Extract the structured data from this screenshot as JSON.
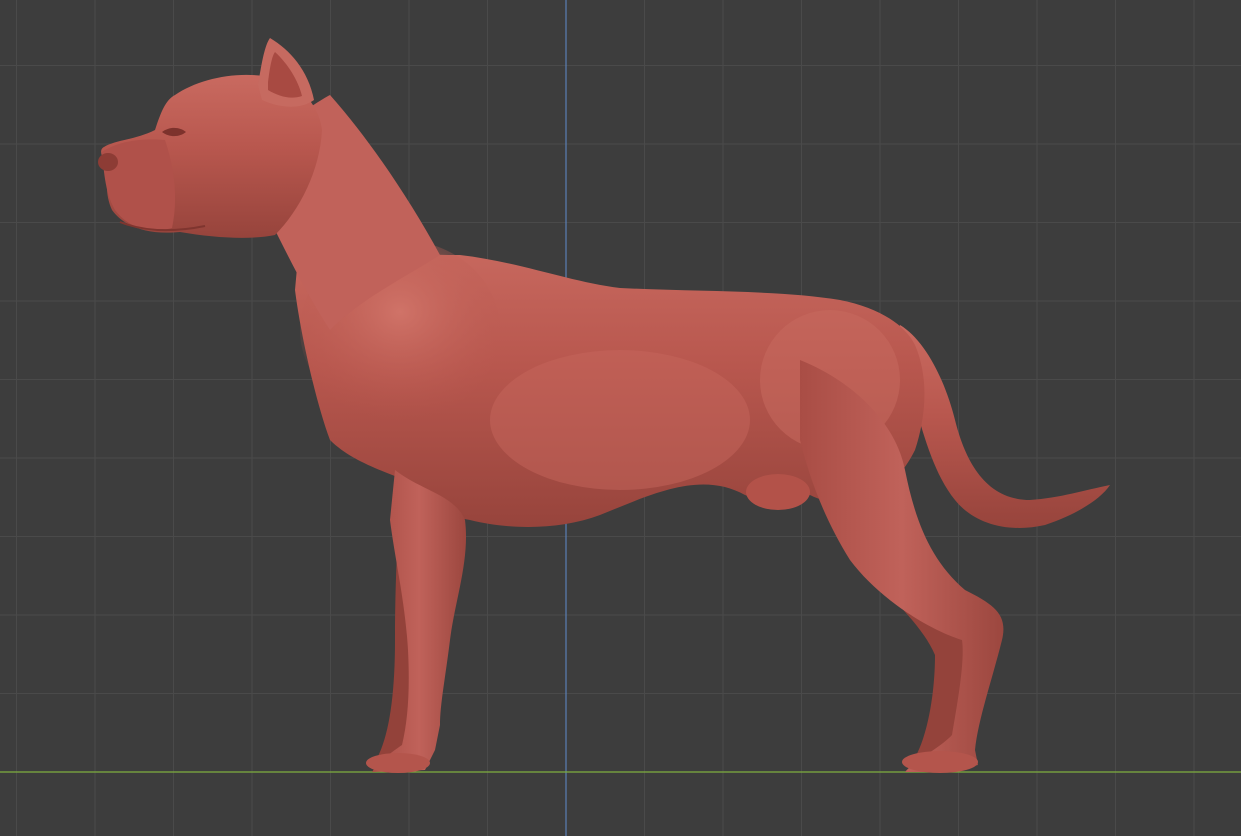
{
  "viewport": {
    "view": "side-orthographic",
    "background_color": "#3d3d3d",
    "grid_color": "#4a4a4a",
    "grid_visible": true,
    "z_axis_color": "#5a7fb5",
    "y_axis_color": "#7fae3f"
  },
  "model": {
    "icon": "dog-sculpt-icon",
    "subject": "dog",
    "shading": "clay",
    "base_color": "#b8574e",
    "highlight_color": "#cf6f64",
    "shadow_color": "#8f3f38"
  }
}
